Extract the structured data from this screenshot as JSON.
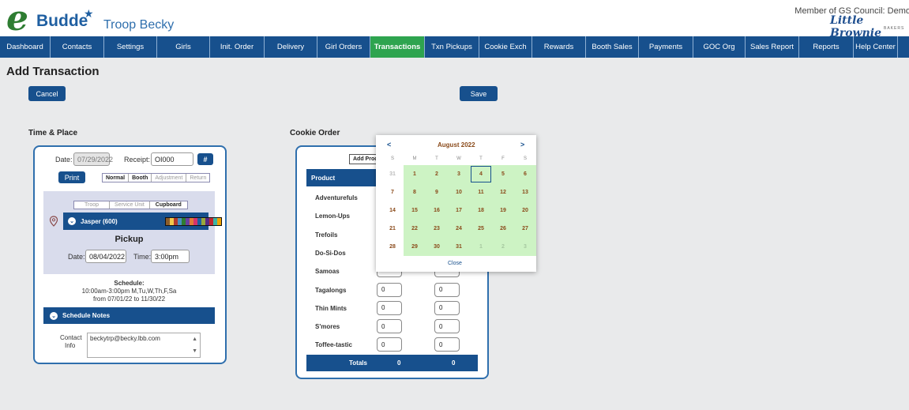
{
  "header": {
    "logo_e": "e",
    "logo_text": "Budde",
    "troop": "Troop Becky",
    "council": "Member of GS Council: Demo",
    "bakery": "Little Brownie",
    "bakery_sub": "BAKERS"
  },
  "nav": [
    {
      "label": "Dashboard",
      "active": false
    },
    {
      "label": "Contacts",
      "active": false
    },
    {
      "label": "Settings",
      "active": false
    },
    {
      "label": "Girls",
      "active": false
    },
    {
      "label": "Init. Order",
      "active": false
    },
    {
      "label": "Delivery",
      "active": false
    },
    {
      "label": "Girl Orders",
      "active": false
    },
    {
      "label": "Transactions",
      "active": true
    },
    {
      "label": "Txn Pickups",
      "active": false
    },
    {
      "label": "Cookie Exch",
      "active": false
    },
    {
      "label": "Rewards",
      "active": false
    },
    {
      "label": "Booth Sales",
      "active": false
    },
    {
      "label": "Payments",
      "active": false
    },
    {
      "label": "GOC Org",
      "active": false
    },
    {
      "label": "Sales Report",
      "active": false
    },
    {
      "label": "Reports",
      "active": false
    },
    {
      "label": "Help Center",
      "active": false
    }
  ],
  "page": {
    "title": "Add Transaction",
    "cancel": "Cancel",
    "save": "Save"
  },
  "time_place": {
    "title": "Time & Place",
    "date_label": "Date:",
    "date_value": "07/29/2022",
    "receipt_label": "Receipt:",
    "receipt_value": "OI000",
    "hash_btn": "#",
    "print_btn": "Print",
    "types": [
      "Normal",
      "Booth",
      "Adjustment",
      "Return"
    ],
    "sources": [
      "Troop",
      "Service Unit",
      "Cupboard"
    ],
    "location_name": "Jasper (600)",
    "swatch_colors": [
      "#8b5e2b",
      "#f2c94c",
      "#b03a2e",
      "#4a90c2",
      "#2e7d32",
      "#6b3fa0",
      "#e07b39",
      "#d6336c",
      "#1f5fa1",
      "#9aa83c",
      "#5a2a82",
      "#c4262e",
      "#3cb5a5",
      "#f0a500"
    ],
    "pickup_title": "Pickup",
    "pickup_date_label": "Date:",
    "pickup_date_value": "08/04/2022",
    "pickup_time_label": "Time:",
    "pickup_time_value": "3:00pm",
    "schedule_title": "Schedule:",
    "schedule_line1": "10:00am-3:00pm M,Tu,W,Th,F,Sa",
    "schedule_line2": "from 07/01/22 to 11/30/22",
    "schedule_notes": "Schedule Notes",
    "contact_label_1": "Contact",
    "contact_label_2": "Info",
    "contact_value": "beckytrp@becky.lbb.com"
  },
  "cookie_order": {
    "title": "Cookie Order",
    "add_product_btn": "Add Prod",
    "col_product": "Product",
    "rows": [
      {
        "name": "Adventurefuls",
        "a": "",
        "b": ""
      },
      {
        "name": "Lemon-Ups",
        "a": "",
        "b": ""
      },
      {
        "name": "Trefoils",
        "a": "",
        "b": ""
      },
      {
        "name": "Do-Si-Dos",
        "a": "",
        "b": ""
      },
      {
        "name": "Samoas",
        "a": "",
        "b": ""
      },
      {
        "name": "Tagalongs",
        "a": "0",
        "b": "0"
      },
      {
        "name": "Thin Mints",
        "a": "0",
        "b": "0"
      },
      {
        "name": "S'mores",
        "a": "0",
        "b": "0"
      },
      {
        "name": "Toffee-tastic",
        "a": "0",
        "b": "0"
      }
    ],
    "totals_label": "Totals",
    "total_a": "0",
    "total_b": "0"
  },
  "calendar": {
    "month": "August 2022",
    "prev": "<",
    "next": ">",
    "dow": [
      "S",
      "M",
      "T",
      "W",
      "T",
      "F",
      "S"
    ],
    "weeks": [
      [
        {
          "d": "31",
          "m": true,
          "a": false
        },
        {
          "d": "1",
          "a": true
        },
        {
          "d": "2",
          "a": true
        },
        {
          "d": "3",
          "a": true
        },
        {
          "d": "4",
          "a": true,
          "s": true
        },
        {
          "d": "5",
          "a": true
        },
        {
          "d": "6",
          "a": true
        }
      ],
      [
        {
          "d": "7",
          "a": false
        },
        {
          "d": "8",
          "a": true
        },
        {
          "d": "9",
          "a": true
        },
        {
          "d": "10",
          "a": true
        },
        {
          "d": "11",
          "a": true
        },
        {
          "d": "12",
          "a": true
        },
        {
          "d": "13",
          "a": true
        }
      ],
      [
        {
          "d": "14",
          "a": false
        },
        {
          "d": "15",
          "a": true
        },
        {
          "d": "16",
          "a": true
        },
        {
          "d": "17",
          "a": true
        },
        {
          "d": "18",
          "a": true
        },
        {
          "d": "19",
          "a": true
        },
        {
          "d": "20",
          "a": true
        }
      ],
      [
        {
          "d": "21",
          "a": false
        },
        {
          "d": "22",
          "a": true
        },
        {
          "d": "23",
          "a": true
        },
        {
          "d": "24",
          "a": true
        },
        {
          "d": "25",
          "a": true
        },
        {
          "d": "26",
          "a": true
        },
        {
          "d": "27",
          "a": true
        }
      ],
      [
        {
          "d": "28",
          "a": false
        },
        {
          "d": "29",
          "a": true
        },
        {
          "d": "30",
          "a": true
        },
        {
          "d": "31",
          "a": true
        },
        {
          "d": "1",
          "m": true,
          "a": true
        },
        {
          "d": "2",
          "m": true,
          "a": true
        },
        {
          "d": "3",
          "m": true,
          "a": true
        }
      ]
    ],
    "close": "Close"
  }
}
